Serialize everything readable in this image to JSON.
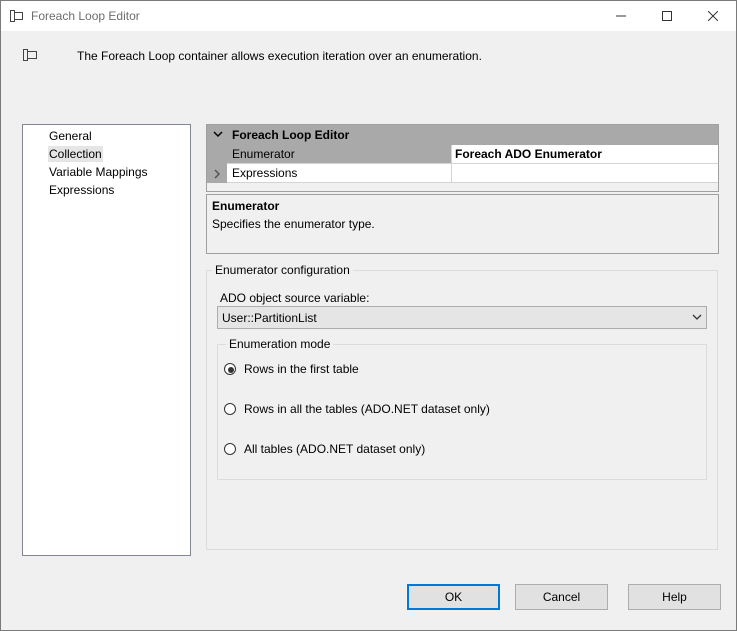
{
  "window": {
    "title": "Foreach Loop Editor",
    "description": "The Foreach Loop container allows execution iteration over an enumeration."
  },
  "nav": {
    "items": [
      {
        "label": "General"
      },
      {
        "label": "Collection",
        "selected": true
      },
      {
        "label": "Variable Mappings"
      },
      {
        "label": "Expressions"
      }
    ]
  },
  "grid": {
    "header": "Foreach Loop Editor",
    "rows": [
      {
        "name": "Enumerator",
        "value": "Foreach ADO Enumerator"
      },
      {
        "name": "Expressions",
        "value": ""
      }
    ]
  },
  "help": {
    "title": "Enumerator",
    "text": "Specifies the enumerator type."
  },
  "config": {
    "legend": "Enumerator configuration",
    "source_label": "ADO object source variable:",
    "source_value": "User::PartitionList",
    "mode_legend": "Enumeration mode",
    "modes": [
      {
        "label": "Rows in the first table",
        "checked": true
      },
      {
        "label": "Rows in all the tables (ADO.NET dataset only)",
        "checked": false
      },
      {
        "label": "All tables (ADO.NET dataset only)",
        "checked": false
      }
    ]
  },
  "buttons": {
    "ok": "OK",
    "cancel": "Cancel",
    "help": "Help"
  },
  "colors": {
    "accent": "#0078d7",
    "grid_header": "#a9a9a9",
    "background": "#f0f0f0"
  }
}
